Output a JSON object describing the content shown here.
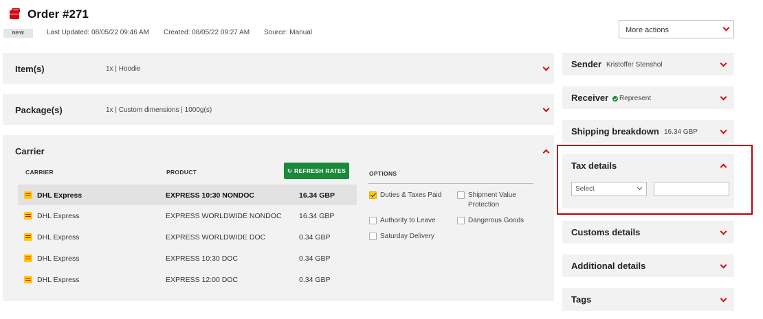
{
  "header": {
    "title": "Order #271",
    "status_badge": "NEW",
    "last_updated": "Last Updated: 08/05/22 09:46 AM",
    "created": "Created: 08/05/22 09:27 AM",
    "source": "Source: Manual",
    "icon": "package-icon"
  },
  "more_actions": {
    "label": "More actions"
  },
  "items_panel": {
    "title": "Item(s)",
    "summary": "1x | Hoodie"
  },
  "packages_panel": {
    "title": "Package(s)",
    "summary": "1x | Custom dimensions | 1000g(s)"
  },
  "carrier_panel": {
    "title": "Carrier",
    "columns": {
      "carrier": "CARRIER",
      "product": "PRODUCT"
    },
    "refresh_label": "REFRESH RATES",
    "rates": [
      {
        "carrier": "DHL Express",
        "product": "EXPRESS 10:30 NONDOC",
        "price": "16.34 GBP",
        "selected": true
      },
      {
        "carrier": "DHL Express",
        "product": "EXPRESS WORLDWIDE NONDOC",
        "price": "16.34 GBP",
        "selected": false
      },
      {
        "carrier": "DHL Express",
        "product": "EXPRESS WORLDWIDE DOC",
        "price": "0.34 GBP",
        "selected": false
      },
      {
        "carrier": "DHL Express",
        "product": "EXPRESS 10:30 DOC",
        "price": "0.34 GBP",
        "selected": false
      },
      {
        "carrier": "DHL Express",
        "product": "EXPRESS 12:00 DOC",
        "price": "0.34 GBP",
        "selected": false
      }
    ],
    "options": {
      "heading": "OPTIONS",
      "duties_paid": {
        "label": "Duties & Taxes Paid",
        "checked": true
      },
      "shipment_value": {
        "label_line1": "Shipment Value",
        "label_line2": "Protection",
        "checked": false
      },
      "authority_to_leave": {
        "label": "Authority to Leave",
        "checked": false
      },
      "dangerous_goods": {
        "label": "Dangerous Goods",
        "checked": false
      },
      "saturday_delivery": {
        "label": "Saturday Delivery",
        "checked": false
      }
    }
  },
  "sidebar": {
    "sender": {
      "title": "Sender",
      "value": "Kristoffer Stenshol"
    },
    "receiver": {
      "title": "Receiver",
      "value": "Represent"
    },
    "shipping_breakdown": {
      "title": "Shipping breakdown",
      "value": "16.34 GBP"
    },
    "tax_details": {
      "title": "Tax details",
      "select_value": "Select",
      "input_value": ""
    },
    "customs_details": {
      "title": "Customs details"
    },
    "additional_details": {
      "title": "Additional details"
    },
    "tags": {
      "title": "Tags"
    }
  },
  "colors": {
    "accent": "#d40511",
    "dhl_yellow": "#ffcc00",
    "refresh_green": "#1a8a3a",
    "highlight": "#c00000"
  }
}
